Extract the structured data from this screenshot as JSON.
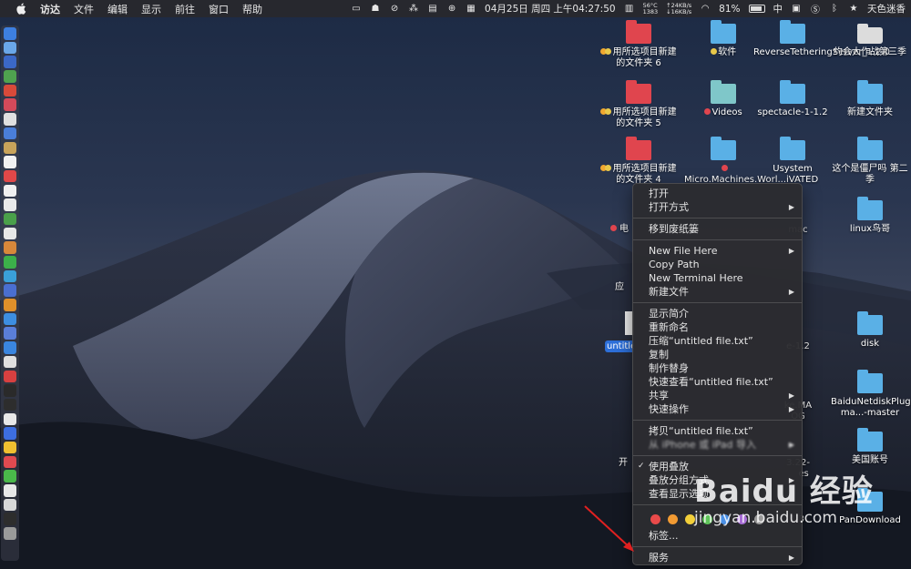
{
  "menubar": {
    "app_name": "访达",
    "menus": [
      "文件",
      "编辑",
      "显示",
      "前往",
      "窗口",
      "帮助"
    ],
    "status": {
      "date_time": "04月25日 周四 上午04:27:50",
      "temp": "56°C",
      "fan": "1383",
      "net_up": "↑24KB/s",
      "net_down": "↓16KB/s",
      "battery": "81%",
      "input_method": "中",
      "user": "天色迷香"
    }
  },
  "desktop_icons": [
    {
      "label": "用所选项目新建的文件夹 6",
      "tag": "#f0a830,#e8c84a",
      "kind": "red"
    },
    {
      "label": "软件",
      "tag": "#e8c84a",
      "kind": "blue"
    },
    {
      "label": "ReverseTetheringServer_1.2.0",
      "tag": "",
      "kind": "blue"
    },
    {
      "label": "约会大作战第三季",
      "tag": "",
      "kind": "drive"
    },
    {
      "label": "用所选项目新建的文件夹 5",
      "tag": "#f0a830,#e8c84a",
      "kind": "red"
    },
    {
      "label": "Videos",
      "tag": "#e0454e",
      "kind": "teal"
    },
    {
      "label": "spectacle-1-1.2",
      "tag": "",
      "kind": "blue"
    },
    {
      "label": "新建文件夹",
      "tag": "",
      "kind": "blue"
    },
    {
      "label": "用所选项目新建的文件夹 4",
      "tag": "#f0a830,#e8c84a",
      "kind": "red"
    },
    {
      "label": "Micro.Machines.Worl...iVATED",
      "tag": "#e0454e",
      "kind": "blue"
    },
    {
      "label": "Usystem",
      "tag": "",
      "kind": "blue"
    },
    {
      "label": "这个是僵尸吗 第二季",
      "tag": "",
      "kind": "blue"
    },
    {
      "label": "linux鸟哥",
      "tag": "",
      "kind": "blue"
    },
    {
      "label": "disk",
      "tag": "",
      "kind": "blue"
    },
    {
      "label": "BaiduNetdiskPlugin-ma...-master",
      "tag": "",
      "kind": "blue"
    },
    {
      "label": "美国账号",
      "tag": "",
      "kind": "blue"
    },
    {
      "label": "PanDownload",
      "tag": "",
      "kind": "blue"
    }
  ],
  "partial_labels": {
    "mac": "mac",
    "v12": "e-1.2",
    "kema": "ke.MA",
    "og": "OG",
    "v322": "3.22-",
    "es": "es",
    "ying": "应",
    "dian": "电",
    "kai": "开",
    "wei": "1.3",
    "jian": "项目新"
  },
  "selected_file": "untitled file.txt",
  "context_menu": {
    "group1": [
      {
        "label": "打开",
        "sub": false
      },
      {
        "label": "打开方式",
        "sub": true
      }
    ],
    "group2": [
      {
        "label": "移到废纸篓",
        "sub": false
      }
    ],
    "group3": [
      {
        "label": "New File Here",
        "sub": true
      },
      {
        "label": "Copy Path",
        "sub": false
      },
      {
        "label": "New Terminal Here",
        "sub": false
      },
      {
        "label": "新建文件",
        "sub": true
      }
    ],
    "group4": [
      {
        "label": "显示简介",
        "sub": false
      },
      {
        "label": "重新命名",
        "sub": false
      },
      {
        "label": "压缩“untitled file.txt”",
        "sub": false
      },
      {
        "label": "复制",
        "sub": false
      },
      {
        "label": "制作替身",
        "sub": false
      },
      {
        "label": "快速查看“untitled file.txt”",
        "sub": false
      },
      {
        "label": "共享",
        "sub": true
      },
      {
        "label": "快速操作",
        "sub": true
      }
    ],
    "group5": [
      {
        "label": "拷贝“untitled file.txt”",
        "sub": false
      },
      {
        "label": "从 iPhone 或 iPad 导入",
        "sub": true
      }
    ],
    "group6": [
      {
        "label": "使用叠放",
        "sub": false,
        "checked": true
      },
      {
        "label": "叠放分组方式",
        "sub": true
      },
      {
        "label": "查看显示选项",
        "sub": false
      }
    ],
    "tag_colors": [
      "#e94a4a",
      "#f29b33",
      "#f2cf3a",
      "#5fc45a",
      "#4a90e6",
      "#a86ed6",
      "#9a9a9a"
    ],
    "tags_label": "标签...",
    "services_label": "服务"
  },
  "watermark": {
    "brand": "Baidu 经验",
    "url": "jingyan.baidu.com"
  },
  "dock_colors": [
    "#3d7fe0",
    "#6aa7e8",
    "#3b68c7",
    "#4fa34f",
    "#d84a3a",
    "#d44a5a",
    "#e0e0e0",
    "#4a7ed8",
    "#c9a45a",
    "#f2f2f2",
    "#e04848",
    "#f0f0f0",
    "#eaeaea",
    "#4aa04a",
    "#e8e8e8",
    "#d8883a",
    "#3cb04a",
    "#3aa0d8",
    "#4a6fd0",
    "#e0902a",
    "#3d8ee0",
    "#5a7ed8",
    "#3a86e0",
    "#e0e0e0",
    "#d84040",
    "#2a2a2a",
    "#2d2d2d",
    "#e8e8e8",
    "#3d6ee0",
    "#f0c030",
    "#e04a50",
    "#4ab84a",
    "#e8e8e8",
    "#d8d8d8",
    "#2d2d2d",
    "#9a9a9a"
  ]
}
